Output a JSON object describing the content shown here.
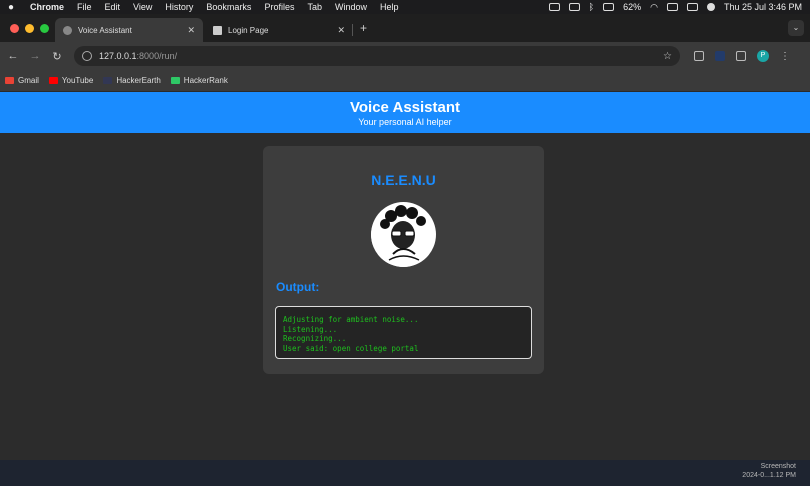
{
  "menubar": {
    "app": "Chrome",
    "items": [
      "File",
      "Edit",
      "View",
      "History",
      "Bookmarks",
      "Profiles",
      "Tab",
      "Window",
      "Help"
    ],
    "battery": "62%",
    "clock": "Thu 25 Jul  3:46 PM"
  },
  "tabs": [
    {
      "title": "Voice Assistant",
      "close": "✕"
    },
    {
      "title": "Login Page",
      "close": "✕"
    }
  ],
  "browser": {
    "url_host": "127.0.0.1",
    "url_rest": ":8000/run/",
    "profile_initial": "P"
  },
  "bookmarks": [
    {
      "label": "Gmail",
      "icon_color": "#ea4335"
    },
    {
      "label": "YouTube",
      "icon_color": "#ff0000"
    },
    {
      "label": "HackerEarth",
      "icon_color": "#323754"
    },
    {
      "label": "HackerRank",
      "icon_color": "#2ec866"
    }
  ],
  "page": {
    "title": "Voice Assistant",
    "subtitle": "Your personal AI helper",
    "assistant_name": "N.E.E.N.U",
    "output_label": "Output:",
    "output_lines": [
      "Adjusting for ambient noise...",
      "Listening...",
      "Recognizing...",
      "User said: open college portal"
    ]
  },
  "screenshot_label": {
    "line1": "Screenshot",
    "line2": "2024-0...1.12 PM"
  },
  "colors": {
    "accent": "#1a8cff",
    "console_text": "#1ec01e"
  }
}
